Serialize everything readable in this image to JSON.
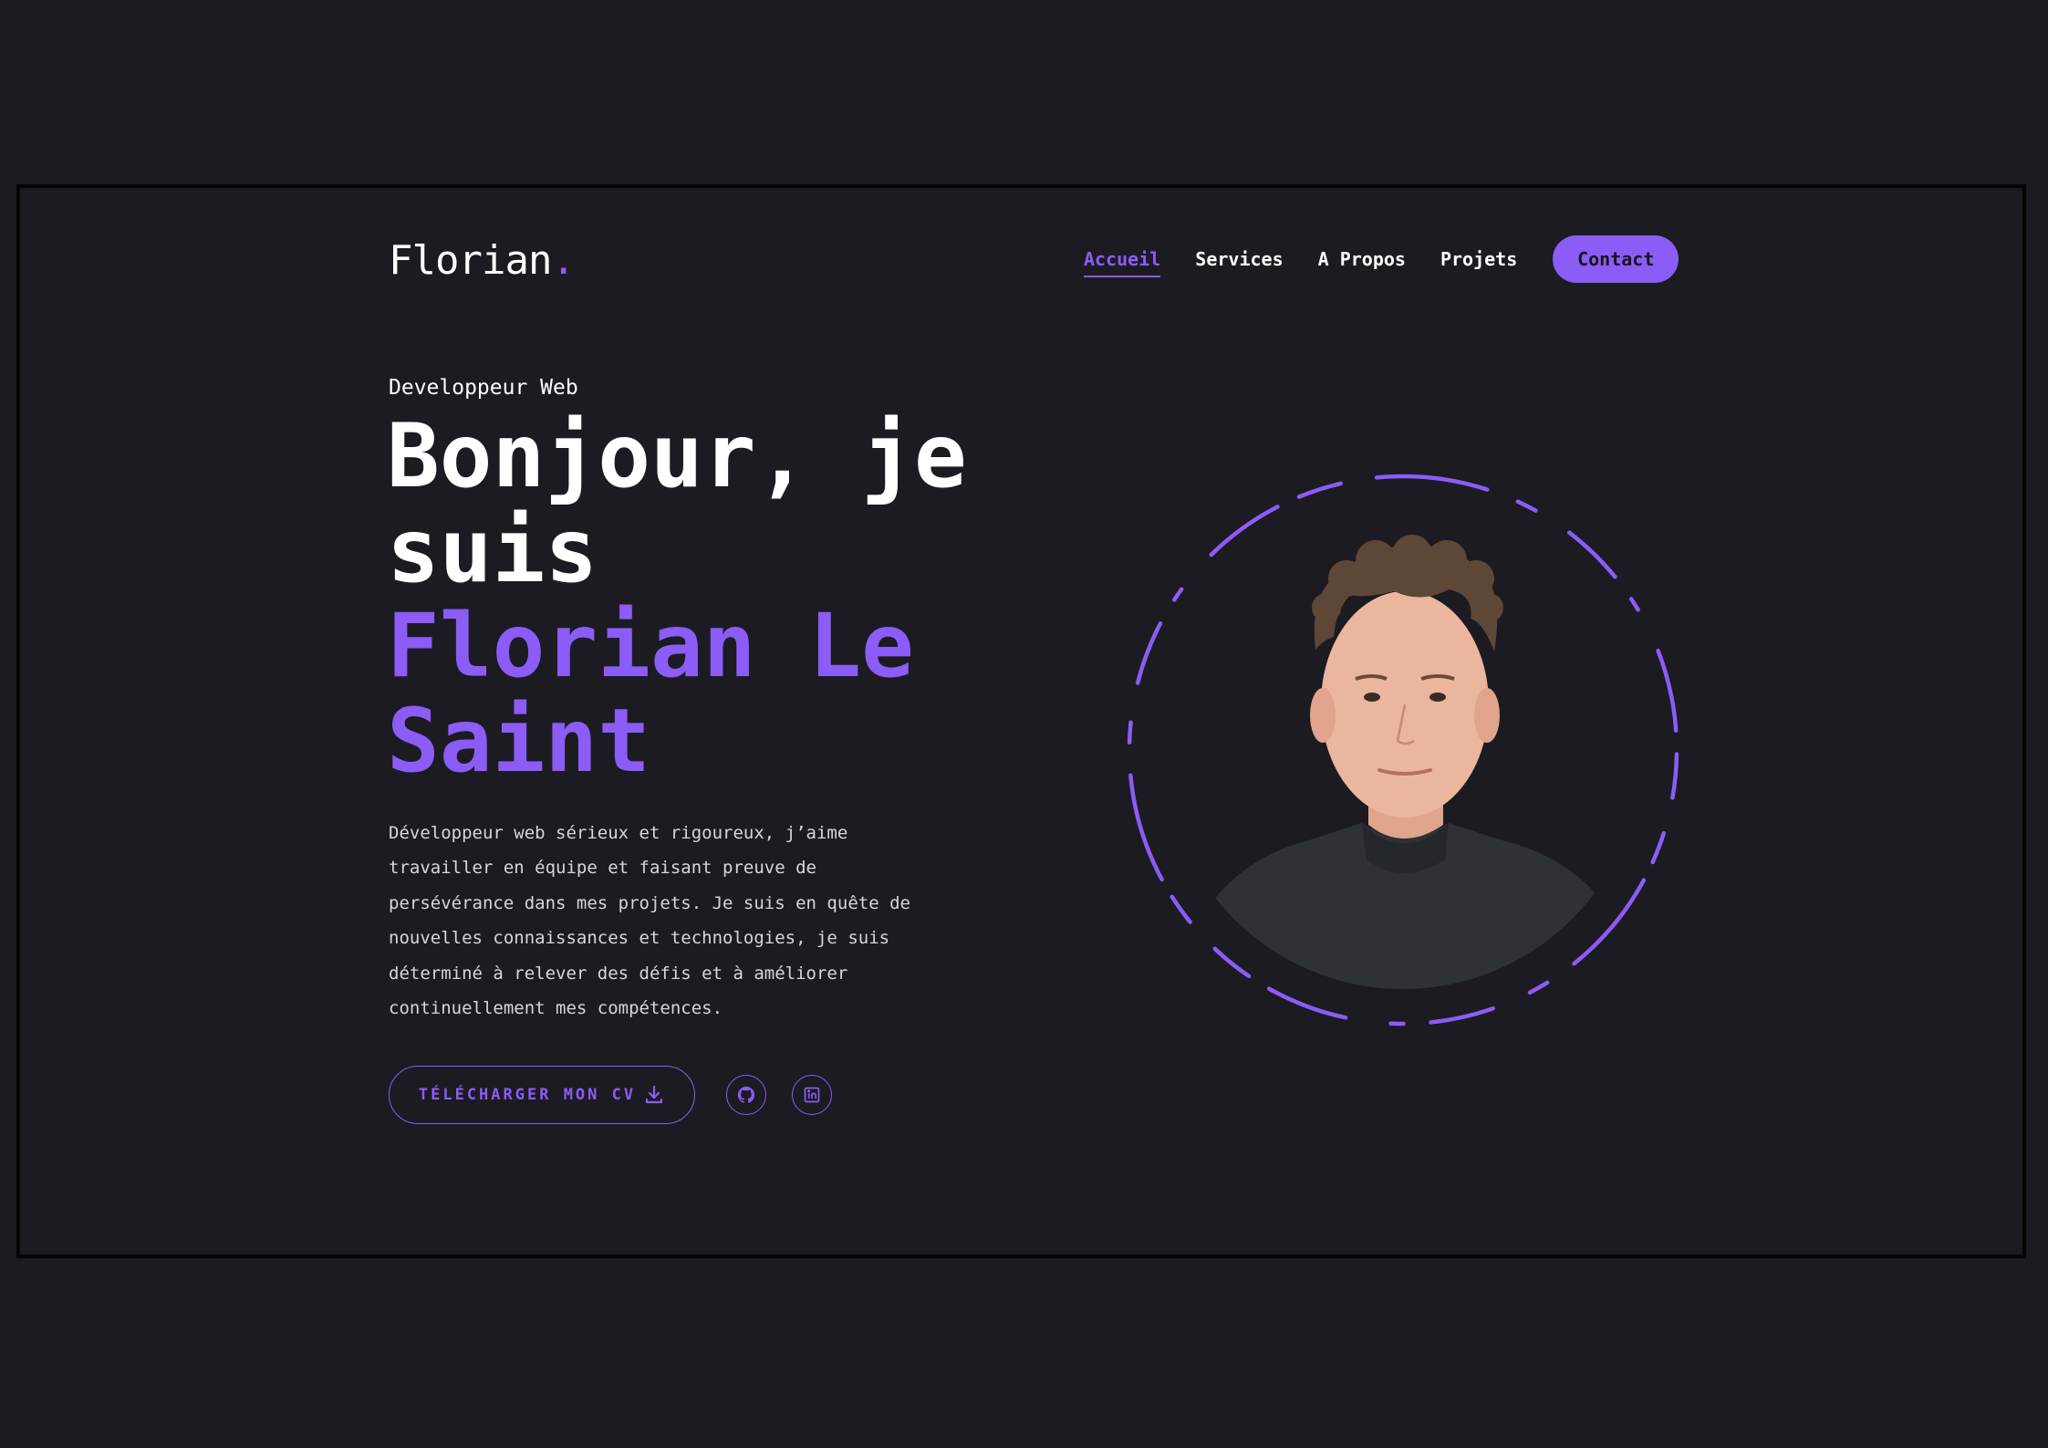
{
  "header": {
    "logo": "Florian",
    "logo_dot": ".",
    "nav": [
      {
        "label": "Accueil",
        "active": true
      },
      {
        "label": "Services",
        "active": false
      },
      {
        "label": "A Propos",
        "active": false
      },
      {
        "label": "Projets",
        "active": false
      }
    ],
    "contact_label": "Contact"
  },
  "hero": {
    "subtitle": "Developpeur Web",
    "headline_line1": "Bonjour, je",
    "headline_line2": "suis",
    "name_line1": "Florian Le",
    "name_line2": "Saint",
    "bio": "Développeur web sérieux et rigoureux, j’aime travailler en équipe et faisant preuve de persévérance dans mes projets. Je suis en quête de nouvelles connaissances et technologies, je suis déterminé à relever des défis et à améliorer continuellement mes compétences.",
    "cv_button": "TÉLÉCHARGER MON CV",
    "icons": {
      "download": "download-icon",
      "github": "github-icon",
      "linkedin": "linkedin-icon"
    }
  },
  "colors": {
    "background": "#1c1b22",
    "accent": "#8b5cf6",
    "text": "#ffffff",
    "frame_border": "#050505"
  }
}
